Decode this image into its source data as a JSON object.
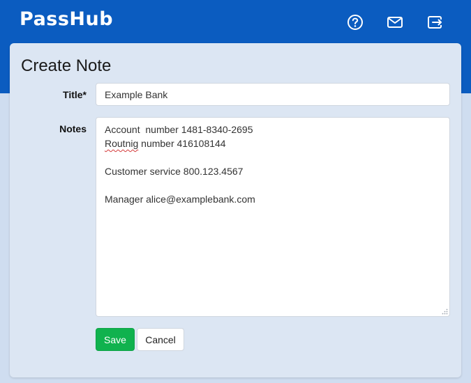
{
  "app": {
    "logo": "PassHub"
  },
  "header": {
    "icons": [
      "help-circle-icon",
      "mail-icon",
      "logout-icon"
    ],
    "brand_color": "#0b5cc0"
  },
  "form": {
    "title": "Create Note",
    "title_label": "Title*",
    "title_value": "Example Bank",
    "notes_label": "Notes",
    "notes_lines": [
      "Account  number 1481-8340-2695",
      "Routnig number 416108144",
      "",
      "Customer service 800.123.4567",
      "",
      "Manager alice@examplebank.com"
    ],
    "save_label": "Save",
    "cancel_label": "Cancel",
    "save_color": "#10b24e"
  }
}
